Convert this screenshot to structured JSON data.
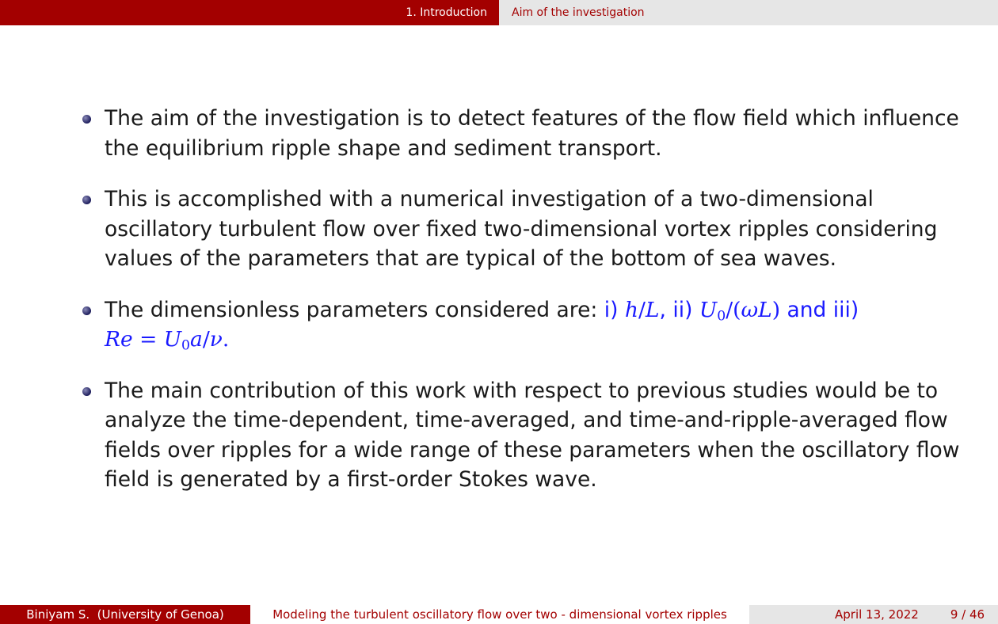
{
  "header": {
    "section": "1. Introduction",
    "subsection": "Aim of the investigation"
  },
  "bullets": [
    {
      "text": "The aim of the investigation is to detect features of the flow field which influence the equilibrium ripple shape and sediment transport."
    },
    {
      "text": "This is accomplished with a numerical investigation of a two-dimensional oscillatory turbulent flow over fixed two-dimensional vortex ripples considering values of the parameters that are typical of the bottom of sea waves."
    },
    {
      "lead": "The dimensionless parameters considered are: ",
      "p1_label": "i)",
      "p2_label": "ii)",
      "and": "and",
      "p3_label": "iii)"
    },
    {
      "text": "The main contribution of this work with respect to previous studies would be to analyze the time-dependent, time-averaged, and time-and-ripple-averaged flow fields over ripples for a wide range of these parameters when the oscillatory flow field is generated by a first-order Stokes wave."
    }
  ],
  "footer": {
    "author": "Biniyam S.  (University of Genoa)",
    "title": "Modeling the turbulent oscillatory flow over two - dimensional vortex ripples",
    "date": "April 13, 2022",
    "page": "9 / 46"
  },
  "colors": {
    "primary": "#a30000",
    "header_right_bg": "#e6e6e6",
    "math_blue": "#1a1aff"
  }
}
